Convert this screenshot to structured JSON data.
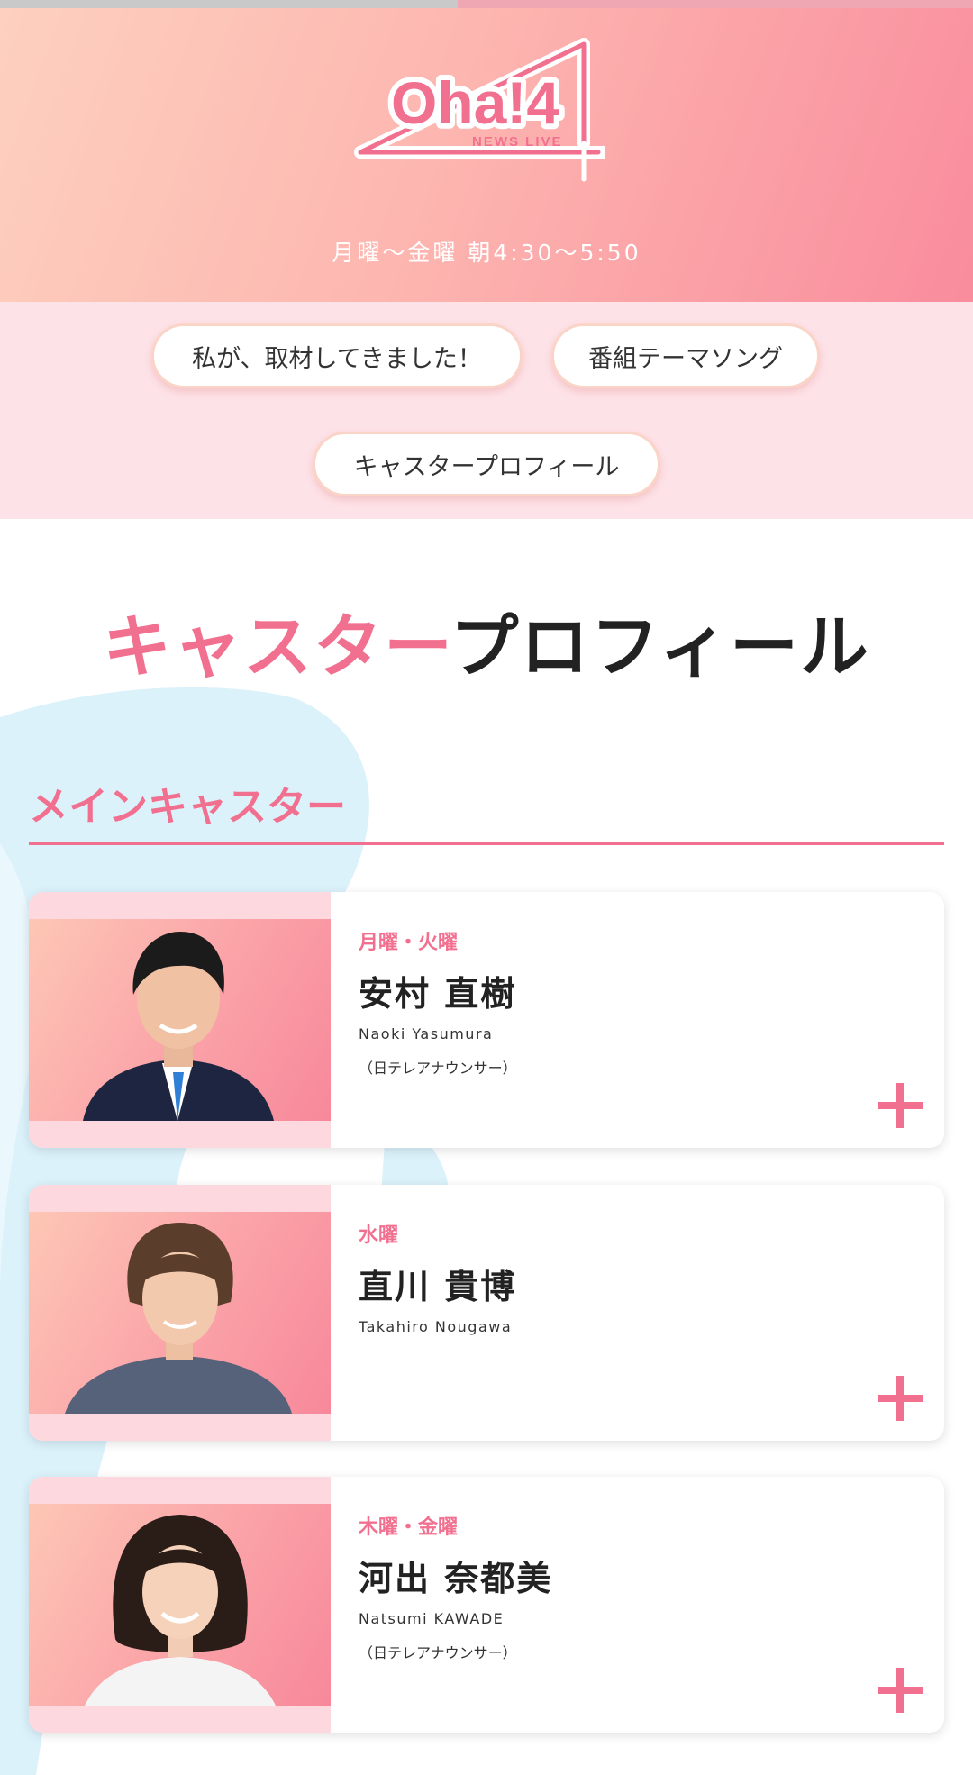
{
  "header": {
    "logo_text": "Oha!4",
    "logo_subtext": "NEWS LIVE",
    "schedule": "月曜～金曜 朝4:30～5:50",
    "scroll_progress": 0.47
  },
  "nav": {
    "items": [
      {
        "label": "私が、取材してきました！"
      },
      {
        "label": "番組テーマソング"
      },
      {
        "label": "キャスタープロフィール"
      }
    ]
  },
  "page": {
    "title_accent": "キャスター",
    "title_rest": "プロフィール"
  },
  "section": {
    "title": "メインキャスター"
  },
  "casters": [
    {
      "day": "月曜・火曜",
      "name": "安村 直樹",
      "roman": "Naoki Yasumura",
      "affiliation": "（日テレアナウンサー）",
      "expand_icon": "plus-icon"
    },
    {
      "day": "水曜",
      "name": "直川 貴博",
      "roman": "Takahiro Nougawa",
      "affiliation": "",
      "expand_icon": "plus-icon"
    },
    {
      "day": "木曜・金曜",
      "name": "河出 奈都美",
      "roman": "Natsumi KAWADE",
      "affiliation": "（日テレアナウンサー）",
      "expand_icon": "plus-icon"
    }
  ],
  "colors": {
    "accent": "#f2708f",
    "header_gradient_start": "#fdd0bf",
    "header_gradient_end": "#f98c9d",
    "nav_background": "#fde2e7",
    "deco_blue": "#dcf2fb"
  }
}
